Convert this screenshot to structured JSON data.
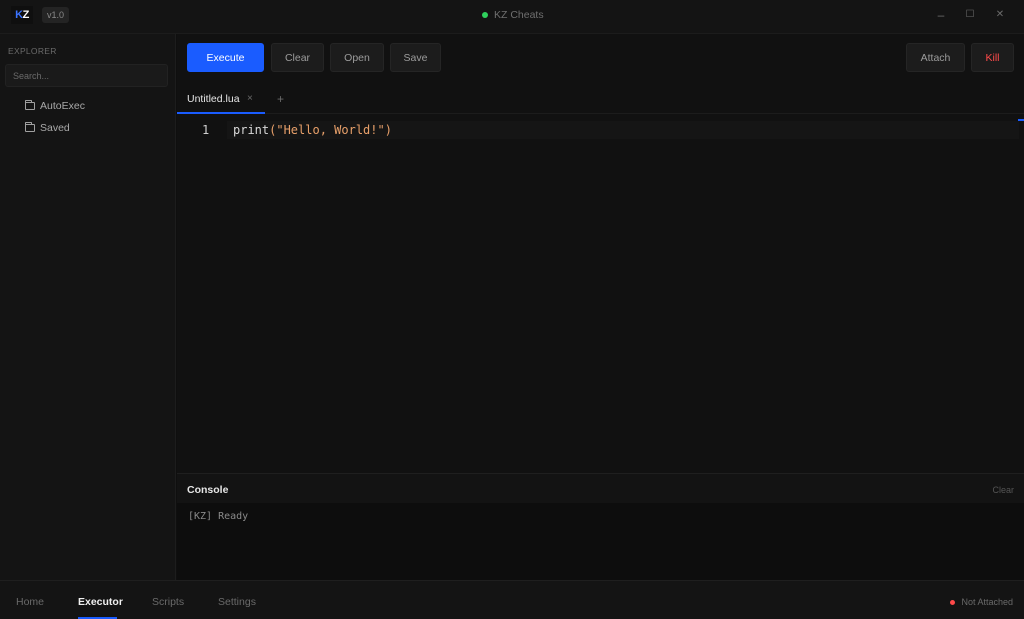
{
  "app": {
    "logo_text": "KZ",
    "version": "v1.0",
    "title": "KZ Cheats",
    "status_dot_color": "#2fd15d"
  },
  "window_controls": {
    "minimize_icon": "minimize-icon",
    "maximize_icon": "maximize-icon",
    "close_icon": "close-icon",
    "minimize_glyph": "–",
    "maximize_glyph": "☐",
    "close_glyph": "✕"
  },
  "sidebar": {
    "section_label": "EXPLORER",
    "search_placeholder": "Search...",
    "folders": [
      {
        "label": "AutoExec",
        "icon": "folder-icon"
      },
      {
        "label": "Saved",
        "icon": "folder-icon"
      }
    ]
  },
  "toolbar": {
    "execute": "Execute",
    "clear": "Clear",
    "open": "Open",
    "save": "Save",
    "attach": "Attach",
    "kill": "Kill",
    "accent_color": "#1a5cff",
    "danger_color": "#ff4a4a"
  },
  "tabs": {
    "items": [
      {
        "label": "Untitled.lua",
        "close_glyph": "×"
      }
    ],
    "add_glyph": "+"
  },
  "editor": {
    "line_number": "1",
    "code_fn": "print",
    "code_open": "(",
    "code_string": "\"Hello, World!\"",
    "code_close": ")"
  },
  "console": {
    "title": "Console",
    "clear_label": "Clear",
    "lines": [
      "[KZ] Ready"
    ]
  },
  "bottom_nav": {
    "items": [
      "Home",
      "Executor",
      "Scripts",
      "Settings"
    ],
    "active": "Executor",
    "status_text": "Not Attached",
    "status_color": "#ff4a4a"
  }
}
